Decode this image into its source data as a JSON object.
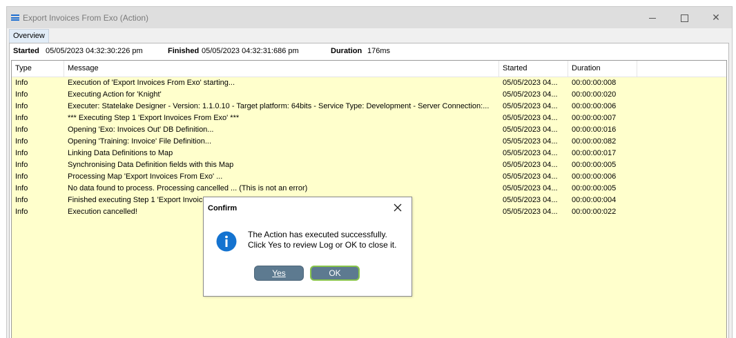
{
  "window": {
    "title": "Export Invoices From Exo (Action)",
    "tab": "Overview",
    "controls": {
      "close": "✕"
    }
  },
  "summary": {
    "started_label": "Started",
    "started_value": "05/05/2023 04:32:30:226 pm",
    "finished_label": "Finished",
    "finished_value": "05/05/2023 04:32:31:686 pm",
    "duration_label": "Duration",
    "duration_value": "176ms"
  },
  "grid": {
    "columns": [
      "Type",
      "Message",
      "Started",
      "Duration"
    ],
    "rows": [
      {
        "type": "Info",
        "message": "Execution of 'Export Invoices From Exo' starting...",
        "started": "05/05/2023 04...",
        "duration": "00:00:00:008"
      },
      {
        "type": "Info",
        "message": "Executing Action for 'Knight'",
        "started": "05/05/2023 04...",
        "duration": "00:00:00:020"
      },
      {
        "type": "Info",
        "message": "Executer: Statelake Designer - Version: 1.1.0.10 - Target platform:  64bits - Service Type: Development - Server Connection:...",
        "started": "05/05/2023 04...",
        "duration": "00:00:00:006"
      },
      {
        "type": "Info",
        "message": "*** Executing Step 1 'Export Invoices From Exo' ***",
        "started": "05/05/2023 04...",
        "duration": "00:00:00:007"
      },
      {
        "type": "Info",
        "message": "Opening 'Exo: Invoices Out' DB Definition...",
        "started": "05/05/2023 04...",
        "duration": "00:00:00:016"
      },
      {
        "type": "Info",
        "message": "Opening 'Training: Invoice' File Definition...",
        "started": "05/05/2023 04...",
        "duration": "00:00:00:082"
      },
      {
        "type": "Info",
        "message": "Linking Data Definitions to Map",
        "started": "05/05/2023 04...",
        "duration": "00:00:00:017"
      },
      {
        "type": "Info",
        "message": "Synchronising Data Definition fields with this Map",
        "started": "05/05/2023 04...",
        "duration": "00:00:00:005"
      },
      {
        "type": "Info",
        "message": "Processing Map 'Export Invoices From Exo' ...",
        "started": "05/05/2023 04...",
        "duration": "00:00:00:006"
      },
      {
        "type": "Info",
        "message": "No data found to process.  Processing cancelled ... (This is not an error)",
        "started": "05/05/2023 04...",
        "duration": "00:00:00:005"
      },
      {
        "type": "Info",
        "message": "Finished executing Step 1 'Export Invoice",
        "started": "05/05/2023 04...",
        "duration": "00:00:00:004"
      },
      {
        "type": "Info",
        "message": "Execution cancelled!",
        "started": "05/05/2023 04...",
        "duration": "00:00:00:022"
      }
    ]
  },
  "dialog": {
    "title": "Confirm",
    "close": "✕",
    "line1": "The Action has executed successfully.",
    "line2": "Click Yes to review Log or OK to close it.",
    "yes_label": "Yes",
    "ok_label": "OK",
    "icon": "info-icon"
  },
  "colors": {
    "grid_background": "#ffffcc",
    "button": "#5d7a90",
    "ok_focus": "#88c44a",
    "info_icon": "#1473d0"
  }
}
